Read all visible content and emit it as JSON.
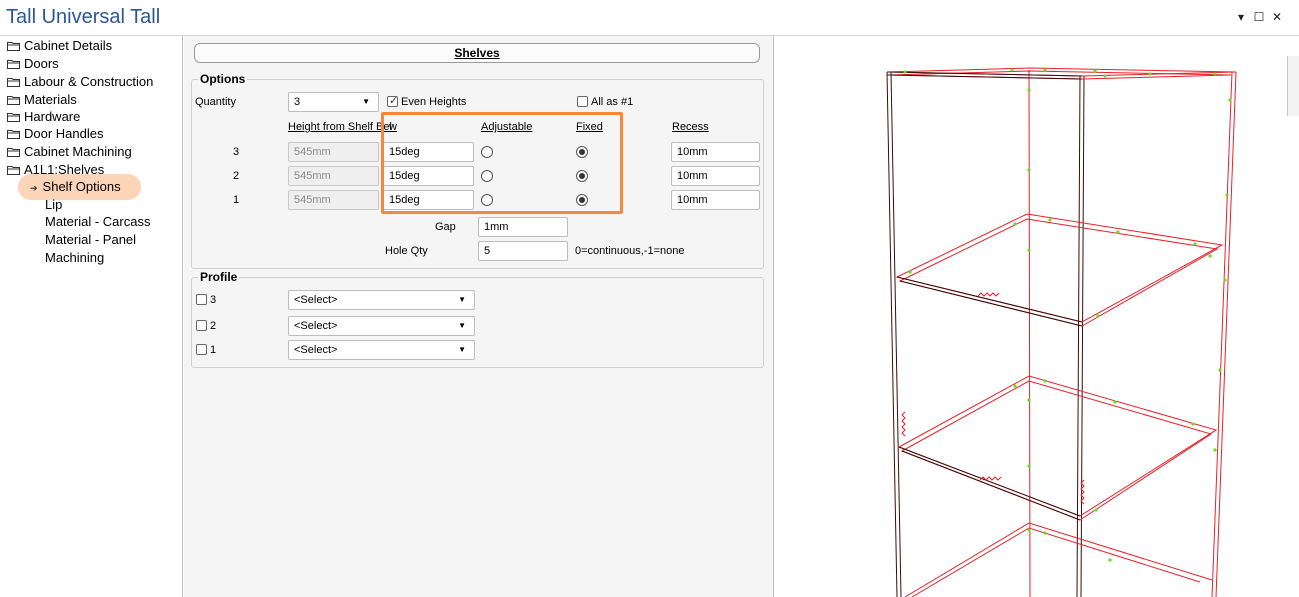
{
  "window": {
    "title": "Tall Universal Tall",
    "controls": {
      "dropdown": "▾",
      "maximize": "☐",
      "close": "✕"
    }
  },
  "tree": {
    "folders": [
      "Cabinet Details",
      "Doors",
      "Labour & Construction",
      "Materials",
      "Hardware",
      "Door Handles",
      "Cabinet Machining",
      "A1L1:Shelves"
    ],
    "children": {
      "selected": "Shelf Options",
      "others": [
        "Lip",
        "Material - Carcass",
        "Material - Panel",
        "Machining"
      ]
    },
    "arrow": "➔"
  },
  "shelves": {
    "header": "Shelves",
    "options": {
      "title": "Options",
      "quantity_label": "Quantity",
      "quantity_value": "3",
      "even_heights_label": "Even Heights",
      "even_heights_checked": true,
      "all_as_1_label": "All as #1",
      "all_as_1_checked": false,
      "columns": {
        "height": "Height from Shelf Below",
        "adjustable": "Adjustable",
        "fixed": "Fixed",
        "recess": "Recess"
      },
      "rows": [
        {
          "num": "3",
          "height": "545mm",
          "angle": "15deg",
          "mode": "fixed",
          "recess": "10mm"
        },
        {
          "num": "2",
          "height": "545mm",
          "angle": "15deg",
          "mode": "fixed",
          "recess": "10mm"
        },
        {
          "num": "1",
          "height": "545mm",
          "angle": "15deg",
          "mode": "fixed",
          "recess": "10mm"
        }
      ],
      "gap_label": "Gap",
      "gap_value": "1mm",
      "hole_qty_label": "Hole Qty",
      "hole_qty_value": "5",
      "hole_qty_hint": "0=continuous,-1=none"
    },
    "profile": {
      "title": "Profile",
      "rows": [
        {
          "num": "3",
          "value": "<Select>"
        },
        {
          "num": "2",
          "value": "<Select>"
        },
        {
          "num": "1",
          "value": "<Select>"
        }
      ]
    }
  },
  "colors": {
    "title_blue": "#2b579a",
    "highlight_orange": "#f5893b",
    "selected_fill": "#fcd4b8",
    "wire_red": "#e8202a",
    "wire_dark": "#3a0c0c",
    "point_green": "#66dd22"
  }
}
